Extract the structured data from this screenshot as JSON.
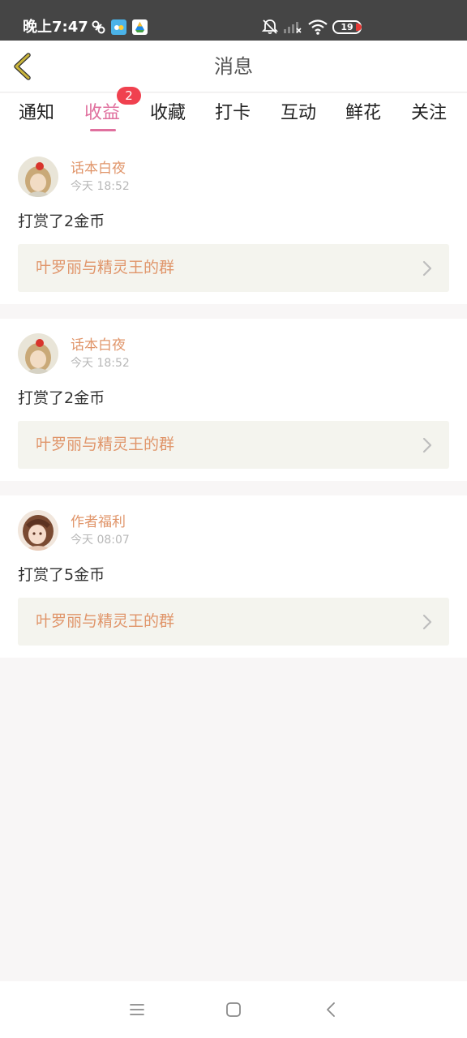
{
  "status_bar": {
    "time": "晚上7:47",
    "battery": "19"
  },
  "header": {
    "title": "消息",
    "back_icon": "chevron-left-icon"
  },
  "tabs": [
    {
      "label": "通知"
    },
    {
      "label": "收益",
      "active": true,
      "badge": "2"
    },
    {
      "label": "收藏"
    },
    {
      "label": "打卡"
    },
    {
      "label": "互动"
    },
    {
      "label": "鲜花"
    },
    {
      "label": "关注"
    }
  ],
  "messages": [
    {
      "author": "话本白夜",
      "time": "今天 18:52",
      "text": "打赏了2金币",
      "group": "叶罗丽与精灵王的群"
    },
    {
      "author": "话本白夜",
      "time": "今天 18:52",
      "text": "打赏了2金币",
      "group": "叶罗丽与精灵王的群"
    },
    {
      "author": "作者福利",
      "time": "今天 08:07",
      "text": "打赏了5金币",
      "group": "叶罗丽与精灵王的群"
    }
  ],
  "colors": {
    "accent": "#e0709e",
    "author": "#e0956a",
    "badge": "#f0414f",
    "back_icon": "#c9b43c"
  },
  "nav_bar": {
    "icons": [
      "menu-icon",
      "home-icon",
      "back-icon"
    ]
  }
}
